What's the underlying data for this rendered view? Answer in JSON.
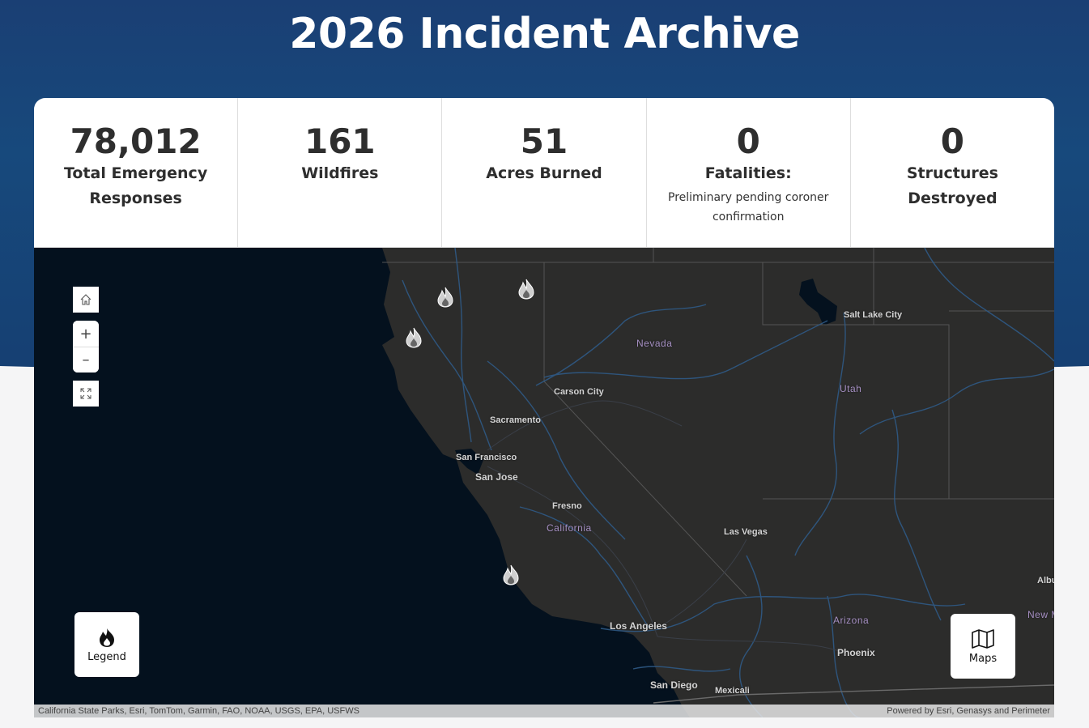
{
  "page": {
    "title": "2026 Incident Archive"
  },
  "stats": [
    {
      "value": "78,012",
      "label": "Total Emergency Responses",
      "note": ""
    },
    {
      "value": "161",
      "label": "Wildfires",
      "note": ""
    },
    {
      "value": "51",
      "label": "Acres Burned",
      "note": ""
    },
    {
      "value": "0",
      "label": "Fatalities:",
      "note": "Preliminary pending coroner confirmation"
    },
    {
      "value": "0",
      "label": "Structures Destroyed",
      "note": ""
    }
  ],
  "map": {
    "controls": {
      "home_icon": "home-icon",
      "zoom_in": "+",
      "zoom_out": "–",
      "fullscreen_icon": "expand-icon"
    },
    "legend_button": {
      "label": "Legend",
      "icon": "fire-icon"
    },
    "maps_button": {
      "label": "Maps",
      "icon": "map-icon"
    },
    "labels": {
      "salt_lake_city": "Salt Lake City",
      "nevada": "Nevada",
      "utah": "Utah",
      "carson_city": "Carson City",
      "sacramento": "Sacramento",
      "san_francisco": "San Francisco",
      "san_jose": "San Jose",
      "fresno": "Fresno",
      "california": "California",
      "las_vegas": "Las Vegas",
      "los_angeles": "Los Angeles",
      "arizona": "Arizona",
      "phoenix": "Phoenix",
      "san_diego": "San Diego",
      "mexicali": "Mexicali",
      "albu": "Albu",
      "new_m": "New M"
    },
    "attribution_left": "California State Parks, Esri, TomTom, Garmin, FAO, NOAA, USGS, EPA, USFWS",
    "attribution_right": "Powered by Esri, Genasys and Perimeter",
    "colors": {
      "ocean": "#04111e",
      "land": "#2c2c2b",
      "water_lines": "#2f5a86",
      "state_label": "#a58fc2"
    }
  }
}
